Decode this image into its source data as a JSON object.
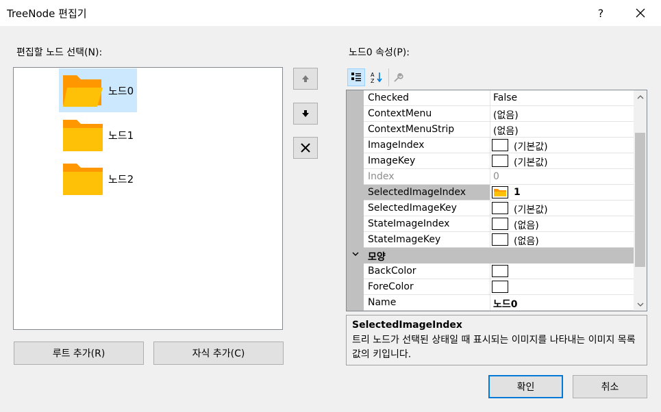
{
  "window": {
    "title": "TreeNode 편집기",
    "help_label": "?",
    "close_label": "✕"
  },
  "tree": {
    "label": "편집할 노드 선택(N):",
    "nodes": [
      {
        "label": "노드0",
        "selected": true
      },
      {
        "label": "노드1",
        "selected": false
      },
      {
        "label": "노드2",
        "selected": false
      }
    ]
  },
  "buttons": {
    "add_root": "루트 추가(R)",
    "add_child": "자식 추가(C)",
    "ok": "확인",
    "cancel": "취소"
  },
  "properties": {
    "label": "노드0 속성(P):",
    "rows": [
      {
        "name": "Checked",
        "value": "False"
      },
      {
        "name": "ContextMenu",
        "value": "(없음)"
      },
      {
        "name": "ContextMenuStrip",
        "value": "(없음)"
      },
      {
        "name": "ImageIndex",
        "value": "(기본값)"
      },
      {
        "name": "ImageKey",
        "value": "(기본값)"
      },
      {
        "name": "Index",
        "value": "0"
      },
      {
        "name": "SelectedImageIndex",
        "value": "1"
      },
      {
        "name": "SelectedImageKey",
        "value": "(기본값)"
      },
      {
        "name": "StateImageIndex",
        "value": "(없음)"
      },
      {
        "name": "StateImageKey",
        "value": "(없음)"
      }
    ],
    "category": "모양",
    "rows2": [
      {
        "name": "BackColor",
        "value": ""
      },
      {
        "name": "ForeColor",
        "value": ""
      },
      {
        "name": "Name",
        "value": "노드0"
      }
    ]
  },
  "description": {
    "title": "SelectedImageIndex",
    "text": "트리 노드가 선택된 상태일 때 표시되는 이미지를 나타내는 이미지 목록 값의 키입니다."
  },
  "colors": {
    "accent": "#0078d7",
    "selection": "#cce8ff",
    "folder": "#ffc107",
    "folder_tab": "#ff9800"
  },
  "icons": [
    "categorized-icon",
    "alphabetical-icon",
    "property-pages-icon",
    "move-up-icon",
    "move-down-icon",
    "delete-icon",
    "folder-icon"
  ]
}
